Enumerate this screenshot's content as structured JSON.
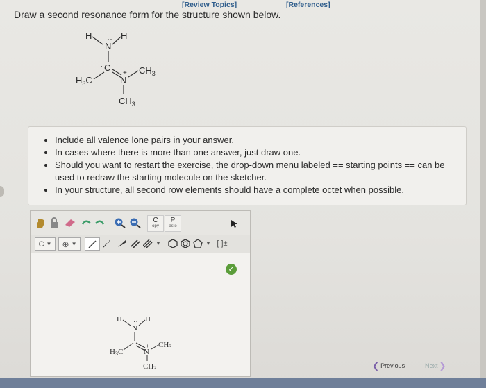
{
  "header": {
    "review_topics": "[Review Topics]",
    "references": "[References]"
  },
  "question": "Draw a second resonance form for the structure shown below.",
  "molecule": {
    "H_left": "H",
    "N_top": "N",
    "H_right": "H",
    "C_label": "C",
    "CH3_right": "CH",
    "H3C_left": "H",
    "N_mid": "N",
    "CH3_bottom": "CH",
    "sub3": "3",
    "sub3b": "3",
    "sub3c": "3",
    "C_left": "C"
  },
  "instructions": [
    "Include all valence lone pairs in your answer.",
    "In cases where there is more than one answer, just draw one.",
    "Should you want to restart the exercise, the drop-down menu labeled == starting points == can be used to redraw the starting molecule on the sketcher.",
    "In your structure, all second row elements should have a complete octet when possible."
  ],
  "toolbar": {
    "copy_label": "C",
    "copy_sub": "opy",
    "paste_label": "P",
    "paste_sub": "aste",
    "element_c": "C",
    "brackets": "[ ]±"
  },
  "nav": {
    "previous": "Previous",
    "next": "Next"
  },
  "colors": {
    "link": "#2f5d8c",
    "ok": "#5b9d3a",
    "bottom_bar": "#6f7f99"
  }
}
